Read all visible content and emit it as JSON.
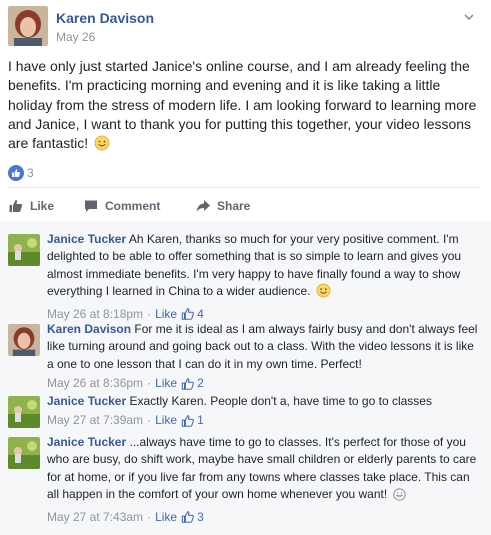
{
  "post": {
    "author": "Karen Davison",
    "date": "May 26",
    "text": "I have only just started Janice's online course, and I am already feeling the benefits. I'm practicing morning and evening and it is like taking a little holiday from the stress of modern life. I am looking forward to learning more and Janice, I want to thank you for putting this together, your video lessons are fantastic!",
    "reaction_count": "3",
    "actions": {
      "like": "Like",
      "comment": "Comment",
      "share": "Share"
    }
  },
  "comments": [
    {
      "author": "Janice Tucker",
      "text": "Ah Karen, thanks so much for your very positive comment. I'm delighted to be able to offer something that is so simple to learn and gives you almost immediate benefits. I'm very happy to have finally found a way to show everything I learned in China to a wider audience.",
      "time": "May 26 at 8:18pm",
      "like_label": "Like",
      "likes": "4"
    },
    {
      "author": "Karen Davison",
      "text": "For me it is ideal as I am always fairly busy and don't always feel like turning around and going back out to a class. With the video lessons it is like a one to one lesson that I can do it in my own time. Perfect!",
      "time": "May 26 at 8:36pm",
      "like_label": "Like",
      "likes": "2"
    },
    {
      "author": "Janice Tucker",
      "text": "Exactly Karen. People don't a, have time to go to classes",
      "time": "May 27 at 7:39am",
      "like_label": "Like",
      "likes": "1"
    },
    {
      "author": "Janice Tucker",
      "text": "...always have time to go to classes. It's perfect for those of you who are busy, do shift work, maybe have small children or elderly parents to care for at home, or if you live far from any towns where classes take place. This can all happen in the comfort of your own home whenever you want!",
      "time": "May 27 at 7:43am",
      "like_label": "Like",
      "likes": "3"
    }
  ],
  "meta_separator": "·"
}
